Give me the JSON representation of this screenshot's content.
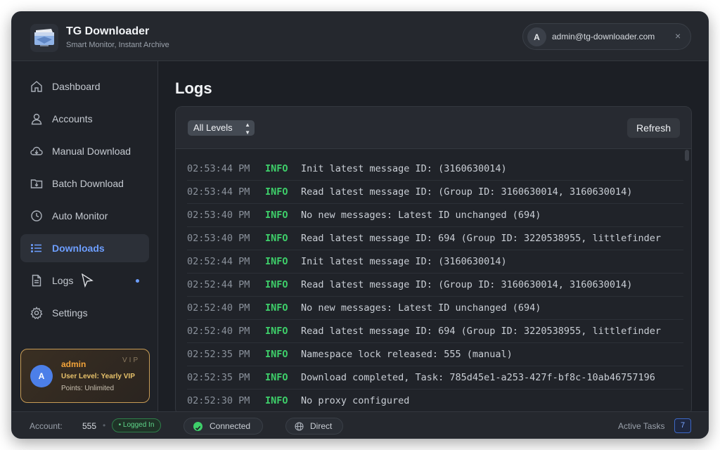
{
  "app": {
    "title": "TG Downloader",
    "subtitle": "Smart Monitor, Instant Archive"
  },
  "user": {
    "avatar_letter": "A",
    "email": "admin@tg-downloader.com",
    "close_glyph": "×"
  },
  "sidebar": {
    "items": [
      {
        "label": "Dashboard",
        "icon": "home-icon"
      },
      {
        "label": "Accounts",
        "icon": "user-icon"
      },
      {
        "label": "Manual Download",
        "icon": "cloud-download-icon"
      },
      {
        "label": "Batch Download",
        "icon": "folder-download-icon"
      },
      {
        "label": "Auto Monitor",
        "icon": "clock-icon"
      },
      {
        "label": "Downloads",
        "icon": "list-icon",
        "active": true
      },
      {
        "label": "Logs",
        "icon": "document-icon",
        "dot": true
      },
      {
        "label": "Settings",
        "icon": "gear-icon"
      }
    ],
    "vip": {
      "avatar_letter": "A",
      "name": "admin",
      "tag": "VIP",
      "level": "User Level:  Yearly VIP",
      "points": "Points: Unlimited"
    }
  },
  "main": {
    "title": "Logs",
    "level_filter": "All Levels",
    "refresh_label": "Refresh",
    "logs": [
      {
        "time": "02:53:44 PM",
        "level": "INFO",
        "message": "Init latest message ID: (3160630014)"
      },
      {
        "time": "02:53:44 PM",
        "level": "INFO",
        "message": "Read latest message ID: (Group ID: 3160630014, 3160630014)"
      },
      {
        "time": "02:53:40 PM",
        "level": "INFO",
        "message": "No new messages: Latest ID unchanged (694)"
      },
      {
        "time": "02:53:40 PM",
        "level": "INFO",
        "message": "Read latest message ID: 694 (Group ID: 3220538955, littlefinder"
      },
      {
        "time": "02:52:44 PM",
        "level": "INFO",
        "message": "Init latest message ID: (3160630014)"
      },
      {
        "time": "02:52:44 PM",
        "level": "INFO",
        "message": "Read latest message ID: (Group ID: 3160630014, 3160630014)"
      },
      {
        "time": "02:52:40 PM",
        "level": "INFO",
        "message": "No new messages: Latest ID unchanged (694)"
      },
      {
        "time": "02:52:40 PM",
        "level": "INFO",
        "message": "Read latest message ID: 694 (Group ID: 3220538955, littlefinder"
      },
      {
        "time": "02:52:35 PM",
        "level": "INFO",
        "message": "Namespace lock released: 555 (manual)"
      },
      {
        "time": "02:52:35 PM",
        "level": "INFO",
        "message": "Download completed, Task: 785d45e1-a253-427f-bf8c-10ab46757196"
      },
      {
        "time": "02:52:30 PM",
        "level": "INFO",
        "message": "No proxy configured"
      }
    ]
  },
  "status": {
    "account_label": "Account:",
    "account_value": "555",
    "separator": "•",
    "logged_in": "• Logged In",
    "connected": "Connected",
    "direct": "Direct",
    "active_tasks_label": "Active Tasks",
    "active_tasks_count": "7"
  },
  "colors": {
    "accent": "#6d9eff",
    "info": "#3ecf6a",
    "vip_gold": "#c79b55",
    "background": "#1c1f25"
  }
}
